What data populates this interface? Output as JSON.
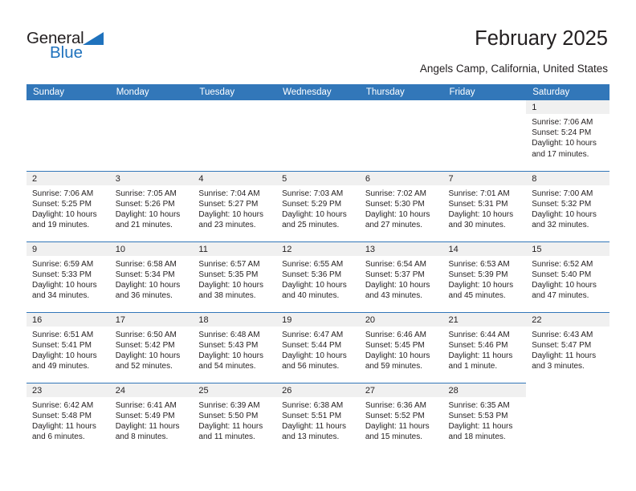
{
  "brand": {
    "name_dark": "General",
    "name_blue": "Blue",
    "accent_color": "#1f72bd"
  },
  "header": {
    "month_title": "February 2025",
    "location": "Angels Camp, California, United States",
    "header_bg": "#3277b9",
    "daynum_bg": "#f0f0f0"
  },
  "calendar": {
    "weekday_headers": [
      "Sunday",
      "Monday",
      "Tuesday",
      "Wednesday",
      "Thursday",
      "Friday",
      "Saturday"
    ],
    "labels": {
      "sunrise": "Sunrise:",
      "sunset": "Sunset:",
      "daylight": "Daylight:"
    },
    "weeks": [
      [
        {
          "day": "",
          "blank": true
        },
        {
          "day": "",
          "blank": true
        },
        {
          "day": "",
          "blank": true
        },
        {
          "day": "",
          "blank": true
        },
        {
          "day": "",
          "blank": true
        },
        {
          "day": "",
          "blank": true
        },
        {
          "day": "1",
          "sunrise": "Sunrise: 7:06 AM",
          "sunset": "Sunset: 5:24 PM",
          "daylight": "Daylight: 10 hours and 17 minutes."
        }
      ],
      [
        {
          "day": "2",
          "sunrise": "Sunrise: 7:06 AM",
          "sunset": "Sunset: 5:25 PM",
          "daylight": "Daylight: 10 hours and 19 minutes."
        },
        {
          "day": "3",
          "sunrise": "Sunrise: 7:05 AM",
          "sunset": "Sunset: 5:26 PM",
          "daylight": "Daylight: 10 hours and 21 minutes."
        },
        {
          "day": "4",
          "sunrise": "Sunrise: 7:04 AM",
          "sunset": "Sunset: 5:27 PM",
          "daylight": "Daylight: 10 hours and 23 minutes."
        },
        {
          "day": "5",
          "sunrise": "Sunrise: 7:03 AM",
          "sunset": "Sunset: 5:29 PM",
          "daylight": "Daylight: 10 hours and 25 minutes."
        },
        {
          "day": "6",
          "sunrise": "Sunrise: 7:02 AM",
          "sunset": "Sunset: 5:30 PM",
          "daylight": "Daylight: 10 hours and 27 minutes."
        },
        {
          "day": "7",
          "sunrise": "Sunrise: 7:01 AM",
          "sunset": "Sunset: 5:31 PM",
          "daylight": "Daylight: 10 hours and 30 minutes."
        },
        {
          "day": "8",
          "sunrise": "Sunrise: 7:00 AM",
          "sunset": "Sunset: 5:32 PM",
          "daylight": "Daylight: 10 hours and 32 minutes."
        }
      ],
      [
        {
          "day": "9",
          "sunrise": "Sunrise: 6:59 AM",
          "sunset": "Sunset: 5:33 PM",
          "daylight": "Daylight: 10 hours and 34 minutes."
        },
        {
          "day": "10",
          "sunrise": "Sunrise: 6:58 AM",
          "sunset": "Sunset: 5:34 PM",
          "daylight": "Daylight: 10 hours and 36 minutes."
        },
        {
          "day": "11",
          "sunrise": "Sunrise: 6:57 AM",
          "sunset": "Sunset: 5:35 PM",
          "daylight": "Daylight: 10 hours and 38 minutes."
        },
        {
          "day": "12",
          "sunrise": "Sunrise: 6:55 AM",
          "sunset": "Sunset: 5:36 PM",
          "daylight": "Daylight: 10 hours and 40 minutes."
        },
        {
          "day": "13",
          "sunrise": "Sunrise: 6:54 AM",
          "sunset": "Sunset: 5:37 PM",
          "daylight": "Daylight: 10 hours and 43 minutes."
        },
        {
          "day": "14",
          "sunrise": "Sunrise: 6:53 AM",
          "sunset": "Sunset: 5:39 PM",
          "daylight": "Daylight: 10 hours and 45 minutes."
        },
        {
          "day": "15",
          "sunrise": "Sunrise: 6:52 AM",
          "sunset": "Sunset: 5:40 PM",
          "daylight": "Daylight: 10 hours and 47 minutes."
        }
      ],
      [
        {
          "day": "16",
          "sunrise": "Sunrise: 6:51 AM",
          "sunset": "Sunset: 5:41 PM",
          "daylight": "Daylight: 10 hours and 49 minutes."
        },
        {
          "day": "17",
          "sunrise": "Sunrise: 6:50 AM",
          "sunset": "Sunset: 5:42 PM",
          "daylight": "Daylight: 10 hours and 52 minutes."
        },
        {
          "day": "18",
          "sunrise": "Sunrise: 6:48 AM",
          "sunset": "Sunset: 5:43 PM",
          "daylight": "Daylight: 10 hours and 54 minutes."
        },
        {
          "day": "19",
          "sunrise": "Sunrise: 6:47 AM",
          "sunset": "Sunset: 5:44 PM",
          "daylight": "Daylight: 10 hours and 56 minutes."
        },
        {
          "day": "20",
          "sunrise": "Sunrise: 6:46 AM",
          "sunset": "Sunset: 5:45 PM",
          "daylight": "Daylight: 10 hours and 59 minutes."
        },
        {
          "day": "21",
          "sunrise": "Sunrise: 6:44 AM",
          "sunset": "Sunset: 5:46 PM",
          "daylight": "Daylight: 11 hours and 1 minute."
        },
        {
          "day": "22",
          "sunrise": "Sunrise: 6:43 AM",
          "sunset": "Sunset: 5:47 PM",
          "daylight": "Daylight: 11 hours and 3 minutes."
        }
      ],
      [
        {
          "day": "23",
          "sunrise": "Sunrise: 6:42 AM",
          "sunset": "Sunset: 5:48 PM",
          "daylight": "Daylight: 11 hours and 6 minutes."
        },
        {
          "day": "24",
          "sunrise": "Sunrise: 6:41 AM",
          "sunset": "Sunset: 5:49 PM",
          "daylight": "Daylight: 11 hours and 8 minutes."
        },
        {
          "day": "25",
          "sunrise": "Sunrise: 6:39 AM",
          "sunset": "Sunset: 5:50 PM",
          "daylight": "Daylight: 11 hours and 11 minutes."
        },
        {
          "day": "26",
          "sunrise": "Sunrise: 6:38 AM",
          "sunset": "Sunset: 5:51 PM",
          "daylight": "Daylight: 11 hours and 13 minutes."
        },
        {
          "day": "27",
          "sunrise": "Sunrise: 6:36 AM",
          "sunset": "Sunset: 5:52 PM",
          "daylight": "Daylight: 11 hours and 15 minutes."
        },
        {
          "day": "28",
          "sunrise": "Sunrise: 6:35 AM",
          "sunset": "Sunset: 5:53 PM",
          "daylight": "Daylight: 11 hours and 18 minutes."
        },
        {
          "day": "",
          "blank": true
        }
      ]
    ]
  }
}
